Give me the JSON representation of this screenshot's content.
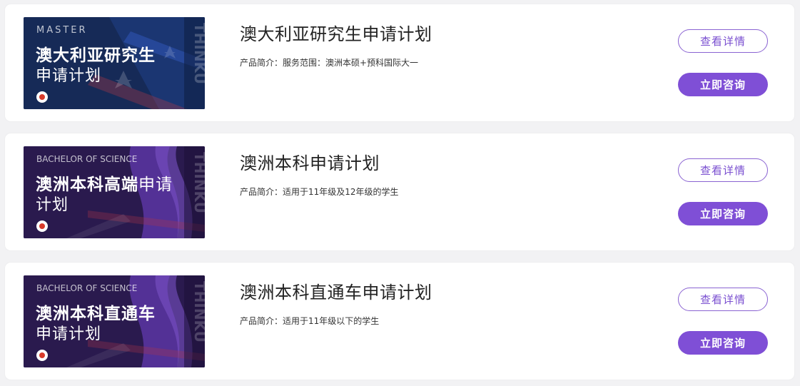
{
  "products": [
    {
      "banner": {
        "tag": "MASTER",
        "title_line1": "澳大利亚研究生",
        "title_line2": "申请计划",
        "watermark": "THINKU",
        "theme": "blue"
      },
      "title": "澳大利亚研究生申请计划",
      "description": "产品简介：服务范围：澳洲本硕+预科国际大一",
      "detail_label": "查看详情",
      "consult_label": "立即咨询"
    },
    {
      "banner": {
        "tag": "BACHELOR OF SCIENCE",
        "title_line1": "澳洲本科高端",
        "title_line1_suffix": "申请",
        "title_line2": "计划",
        "watermark": "THINKU",
        "theme": "purple"
      },
      "title": "澳洲本科申请计划",
      "description": "产品简介：适用于11年级及12年级的学生",
      "detail_label": "查看详情",
      "consult_label": "立即咨询"
    },
    {
      "banner": {
        "tag": "BACHELOR OF SCIENCE",
        "title_line1": "澳洲本科直通车",
        "title_line2": "申请计划",
        "watermark": "THINKU",
        "theme": "purple"
      },
      "title": "澳洲本科直通车申请计划",
      "description": "产品简介：适用于11年级以下的学生",
      "detail_label": "查看详情",
      "consult_label": "立即咨询"
    }
  ],
  "colors": {
    "accent": "#7f4fd6",
    "banner_blue": "#162a57",
    "banner_purple": "#2e1b52",
    "logo_red": "#d83a2a"
  }
}
